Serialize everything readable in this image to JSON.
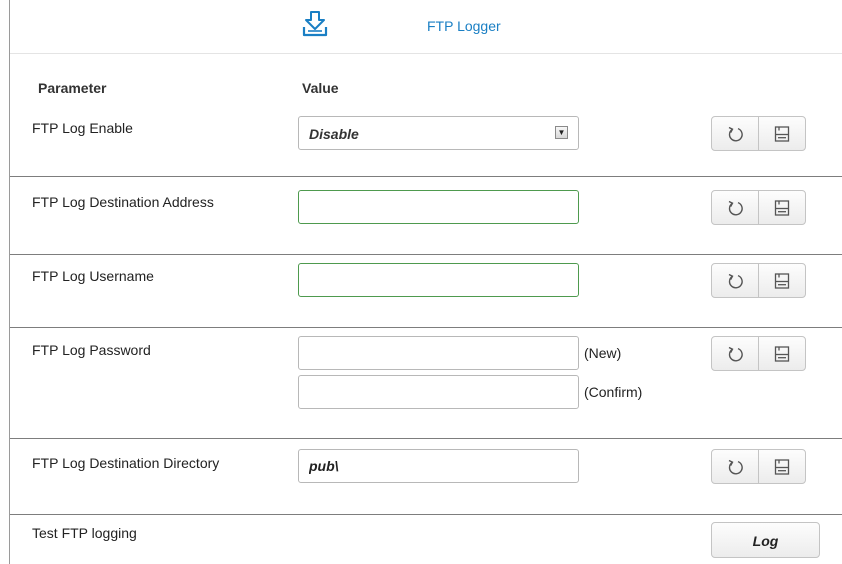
{
  "header": {
    "title": "FTP Logger",
    "icon": "download-tray-icon",
    "accent_color": "#1a7fc4"
  },
  "table": {
    "col_parameter": "Parameter",
    "col_value": "Value"
  },
  "rows": {
    "enable": {
      "label": "FTP Log Enable",
      "selected": "Disable"
    },
    "address": {
      "label": "FTP Log Destination Address",
      "value": ""
    },
    "username": {
      "label": "FTP Log Username",
      "value": ""
    },
    "password": {
      "label": "FTP Log Password",
      "new_value": "",
      "confirm_value": "",
      "new_hint": "(New)",
      "confirm_hint": "(Confirm)"
    },
    "directory": {
      "label": "FTP Log Destination Directory",
      "value": "pub\\"
    },
    "test": {
      "label": "Test FTP logging",
      "button": "Log"
    }
  },
  "icons": {
    "refresh": "refresh-icon",
    "save": "save-icon"
  }
}
